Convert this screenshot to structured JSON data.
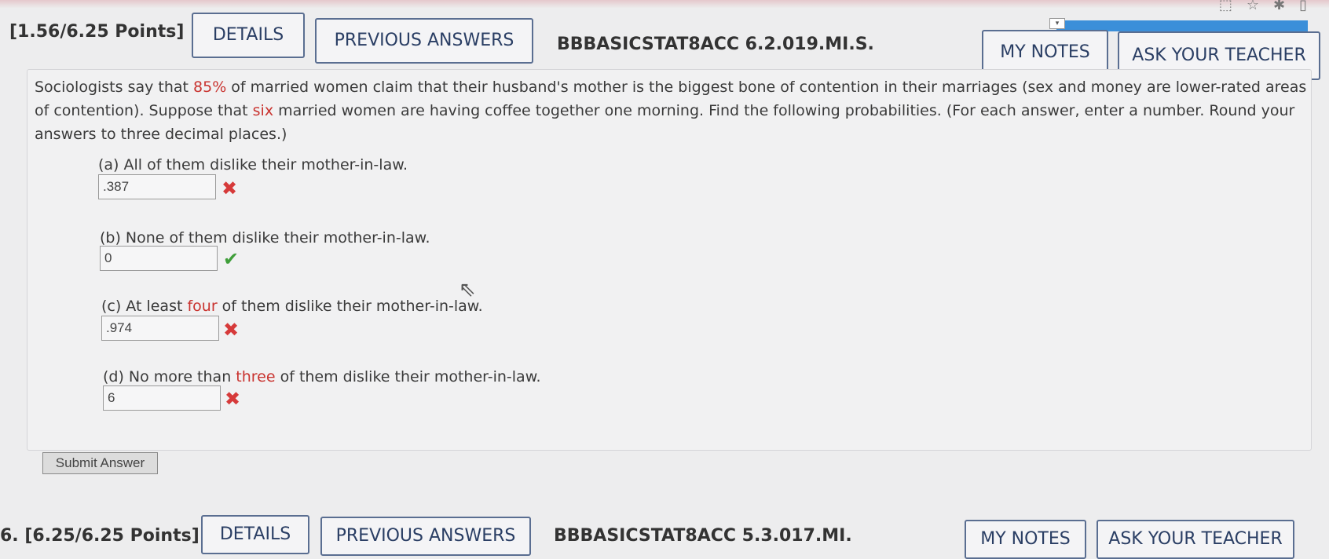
{
  "question": {
    "points": "[1.56/6.25 Points]",
    "details_label": "DETAILS",
    "previous_answers_label": "PREVIOUS ANSWERS",
    "id": "BBBASICSTAT8ACC 6.2.019.MI.S.",
    "my_notes_label": "MY NOTES",
    "ask_teacher_label": "ASK YOUR TEACHER"
  },
  "problem": {
    "t1": "Sociologists say that ",
    "pct": "85%",
    "t2": " of married women claim that their husband's mother is the biggest bone of contention in their marriages (sex and money are lower-rated areas of contention). Suppose that ",
    "count": "six",
    "t3": " married women are having coffee together one morning. Find the following probabilities. (For each answer, enter a number. Round your answers to three decimal places.)"
  },
  "parts": {
    "a": {
      "label": "(a) All of them dislike their mother-in-law.",
      "value": ".387",
      "status": "incorrect"
    },
    "b": {
      "label": "(b) None of them dislike their mother-in-law.",
      "value": "0",
      "status": "correct"
    },
    "c": {
      "pre": "(c) At least ",
      "hl": "four",
      "post": " of them dislike their mother-in-law.",
      "value": ".974",
      "status": "incorrect"
    },
    "d": {
      "pre": "(d) No more than ",
      "hl": "three",
      "post": " of them dislike their mother-in-law.",
      "value": "6",
      "status": "incorrect"
    }
  },
  "submit_label": "Submit Answer",
  "next_question": {
    "number": "6.",
    "points": "[6.25/6.25 Points]",
    "details_label": "DETAILS",
    "previous_answers_label": "PREVIOUS ANSWERS",
    "id": "BBBASICSTAT8ACC 5.3.017.MI.",
    "my_notes_label": "MY NOTES",
    "ask_teacher_label": "ASK YOUR TEACHER"
  },
  "icons": {
    "incorrect": "x-mark-icon",
    "correct": "check-mark-icon",
    "cursor": "mouse-pointer-icon"
  },
  "colors": {
    "highlight": "#c9332f",
    "incorrect": "#d63a3a",
    "correct": "#3f9e3a",
    "button_border": "#5a6e91",
    "blue_bar": "#3b8fd9"
  }
}
